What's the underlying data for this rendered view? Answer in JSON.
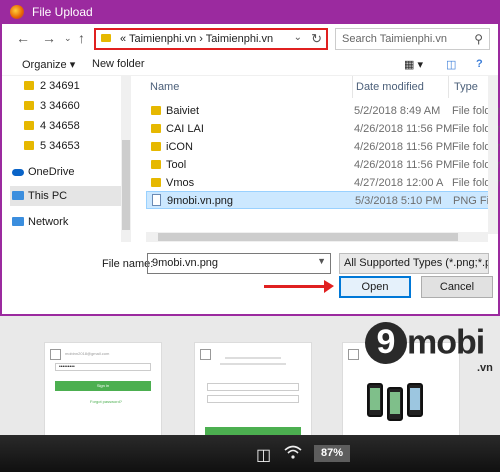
{
  "dialog": {
    "title": "File Upload",
    "accent_color": "#9b2a9f",
    "address": {
      "crumbs": "«  Taimienphi.vn  ›  Taimienphi.vn",
      "highlight_color": "#e02020"
    },
    "search": {
      "placeholder": "Search Taimienphi.vn"
    },
    "toolbar": {
      "organize": "Organize ▾",
      "new_folder": "New folder"
    },
    "sidebar": {
      "items": [
        {
          "label": "2 34691",
          "icon": "folder-icon"
        },
        {
          "label": "3 34660",
          "icon": "folder-icon"
        },
        {
          "label": "4 34658",
          "icon": "folder-icon"
        },
        {
          "label": "5 34653",
          "icon": "folder-icon"
        },
        {
          "label": "OneDrive",
          "icon": "cloud-icon"
        },
        {
          "label": "This PC",
          "icon": "computer-icon",
          "selected": true
        },
        {
          "label": "Network",
          "icon": "network-icon"
        }
      ]
    },
    "columns": {
      "name": "Name",
      "date": "Date modified",
      "type": "Type"
    },
    "files": [
      {
        "name": "Baiviet",
        "date": "5/2/2018 8:49 AM",
        "type": "File folder",
        "kind": "folder"
      },
      {
        "name": "CAI LAI",
        "date": "4/26/2018 11:56 PM",
        "type": "File folder",
        "kind": "folder"
      },
      {
        "name": "iCON",
        "date": "4/26/2018 11:56 PM",
        "type": "File folder",
        "kind": "folder"
      },
      {
        "name": "Tool",
        "date": "4/26/2018 11:56 PM",
        "type": "File folder",
        "kind": "folder"
      },
      {
        "name": "Vmos",
        "date": "4/27/2018 12:00 A",
        "type": "File folder",
        "kind": "folder"
      },
      {
        "name": "9mobi.vn.png",
        "date": "5/3/2018 5:10 PM",
        "type": "PNG File",
        "kind": "png",
        "selected": true
      }
    ],
    "filename_label": "File name:",
    "filename_value": "9mobi.vn.png",
    "filetype_value": "All Supported Types (*.png;*.pn",
    "open_label": "Open",
    "cancel_label": "Cancel"
  },
  "background": {
    "logo_nine": "9",
    "logo_mobi": "mobi",
    "logo_vn": ".vn",
    "card1_email": "mobinn2018@gmail.com",
    "card1_password": "•••••••••",
    "card1_button": "Sign in",
    "card1_link": "Forgot password?",
    "battery": "87%"
  }
}
